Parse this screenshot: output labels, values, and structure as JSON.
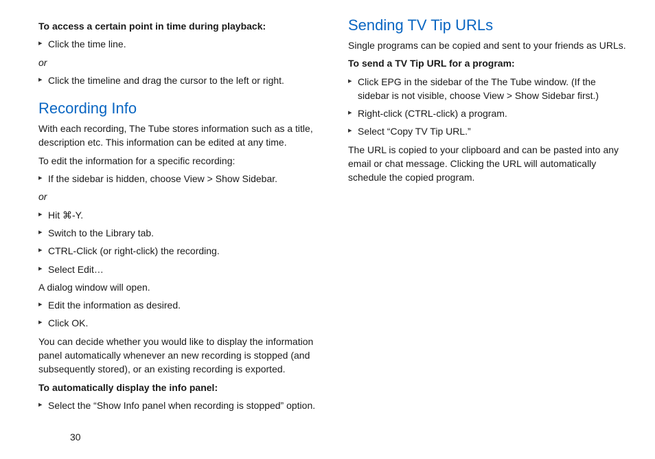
{
  "pageNumber": "30",
  "left": {
    "boldAccess": "To access a certain point in time during playback:",
    "b1": "Click the time line.",
    "or1": "or",
    "b2": "Click the timeline and drag the cursor to the left or right.",
    "heading": "Recording Info",
    "p1": "With each recording, The Tube stores information such as a title, description etc. This information can be edited at any time.",
    "p2": "To edit the information for a specific recording:",
    "b3": "If the sidebar is hidden, choose View > Show Sidebar.",
    "or2": "or",
    "b4": "Hit ⌘-Y.",
    "b5": "Switch to the Library tab.",
    "b6": "CTRL-Click (or right-click) the recording.",
    "b7": "Select Edit…",
    "p3": "A dialog window will open.",
    "b8": "Edit the information as desired.",
    "b9": "Click OK.",
    "p4": "You can decide whether you would like to display the information panel automatically whenever an new recording is stopped (and subsequently stored), or an existing recording is exported.",
    "boldAuto": "To automatically display the info panel:",
    "b10": "Select the “Show Info panel when recording is stopped” option."
  },
  "right": {
    "heading": "Sending TV Tip URLs",
    "p1": "Single programs can be copied and sent to your friends as URLs.",
    "boldSend": "To send a TV Tip URL for a program:",
    "b1": "Click EPG in the sidebar of the The Tube window. (If the sidebar is not visible, choose View > Show Sidebar first.)",
    "b2": "Right-click (CTRL-click) a program.",
    "b3": "Select “Copy TV Tip URL.”",
    "p2": "The URL is copied to your clipboard and can be pasted into any email or chat message. Clicking the URL will automatically schedule the copied  program."
  }
}
